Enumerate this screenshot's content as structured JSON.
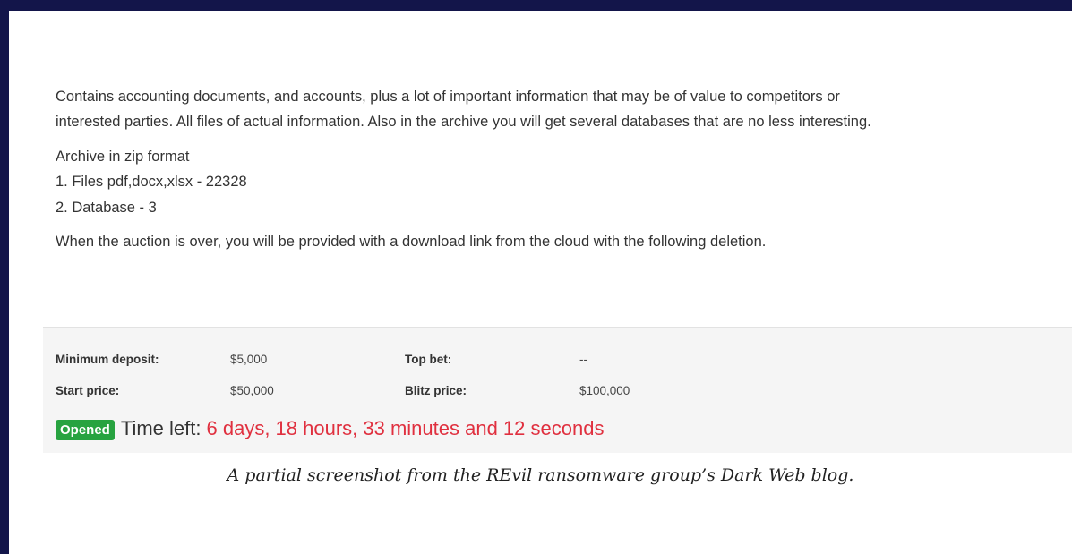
{
  "description": {
    "paragraph1_line1": "Contains accounting documents, and accounts, plus a lot of important information that may be of value to competitors or",
    "paragraph1_line2": "interested parties. All files of actual information. Also in the archive you will get several databases that are no less interesting.",
    "archive_format": "Archive in zip format",
    "item1": "1. Files pdf,docx,xlsx - 22328",
    "item2": "2. Database - 3",
    "paragraph3": "When the auction is over, you will be provided with a download link from the cloud with the following deletion."
  },
  "auction": {
    "min_deposit_label": "Minimum deposit:",
    "min_deposit_value": "$5,000",
    "top_bet_label": "Top bet:",
    "top_bet_value": "--",
    "start_price_label": "Start price:",
    "start_price_value": "$50,000",
    "blitz_price_label": "Blitz price:",
    "blitz_price_value": "$100,000"
  },
  "status": {
    "badge": "Opened",
    "time_left_label": "Time left:",
    "time_left_value": "6 days, 18 hours, 33 minutes and 12 seconds"
  },
  "caption": "A partial screenshot from the REvil ransomware group’s Dark Web blog.",
  "colors": {
    "border": "#13154a",
    "badge_bg": "#27a340",
    "countdown": "#e0303f",
    "panel_bg": "#f5f5f5"
  }
}
